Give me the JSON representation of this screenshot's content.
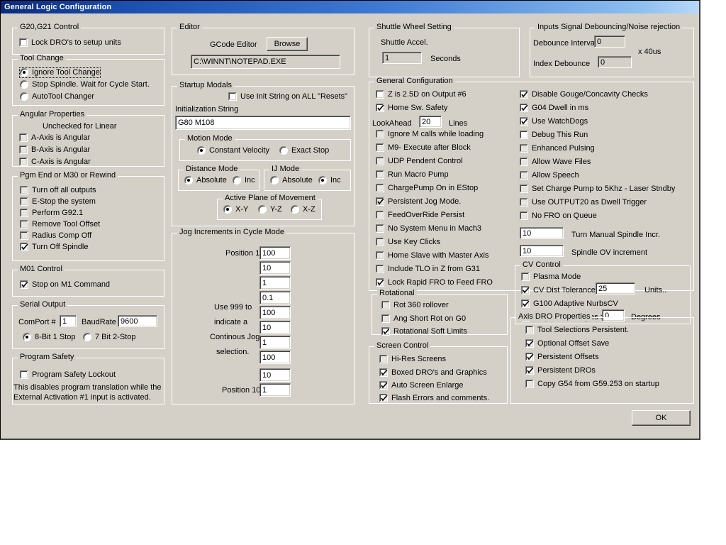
{
  "window": {
    "title": "General Logic Configuration"
  },
  "groups": {
    "g20g21": {
      "title": "G20,G21 Control",
      "lock_dro": {
        "label": "Lock DRO's to setup units",
        "checked": false
      }
    },
    "tool_change": {
      "title": "Tool Change",
      "options": [
        {
          "label": "Ignore Tool Change",
          "selected": true,
          "focused": true
        },
        {
          "label": "Stop Spindle. Wait for Cycle Start.",
          "selected": false,
          "focused": false
        },
        {
          "label": "AutoTool Changer",
          "selected": false,
          "focused": false
        }
      ]
    },
    "angular": {
      "title": "Angular Properties",
      "note": "Unchecked for Linear",
      "items": [
        {
          "label": "A-Axis is Angular",
          "checked": false
        },
        {
          "label": "B-Axis is Angular",
          "checked": false
        },
        {
          "label": "C-Axis is Angular",
          "checked": false
        }
      ]
    },
    "pgm_end": {
      "title": "Pgm End or M30 or Rewind",
      "items": [
        {
          "label": "Turn off all outputs",
          "checked": false
        },
        {
          "label": "E-Stop the system",
          "checked": false
        },
        {
          "label": "Perform G92.1",
          "checked": false
        },
        {
          "label": "Remove Tool Offset",
          "checked": false
        },
        {
          "label": "Radius Comp Off",
          "checked": false
        },
        {
          "label": "Turn Off Spindle",
          "checked": true
        }
      ]
    },
    "m01": {
      "title": "M01 Control",
      "stop_on_m1": {
        "label": "Stop on M1 Command",
        "checked": true
      }
    },
    "serial": {
      "title": "Serial Output",
      "comport_label": "ComPort #",
      "comport_value": "1",
      "baudrate_label": "BaudRate",
      "baudrate_value": "9600",
      "options": [
        {
          "label": "8-Bit 1 Stop",
          "selected": true
        },
        {
          "label": "7 Bit 2-Stop",
          "selected": false
        }
      ]
    },
    "program_safety": {
      "title": "Program Safety",
      "lockout": {
        "label": "Program Safety Lockout",
        "checked": false
      },
      "note_line1": "This disables program translation while the",
      "note_line2": "External Activation #1 input is activated."
    },
    "editor": {
      "title": "Editor",
      "gcode_editor_label": "GCode Editor",
      "browse_label": "Browse",
      "path_value": "C:\\WINNT\\NOTEPAD.EXE"
    },
    "startup_modals": {
      "title": "Startup Modals",
      "use_init_all": {
        "label": "Use Init String on ALL  \"Resets\"",
        "checked": false
      },
      "init_string_label": "Initialization String",
      "init_string_value": "G80 M108",
      "motion_mode": {
        "title": "Motion Mode",
        "options": [
          {
            "label": "Constant Velocity",
            "selected": true
          },
          {
            "label": "Exact Stop",
            "selected": false
          }
        ]
      },
      "distance_mode": {
        "title": "Distance Mode",
        "options": [
          {
            "label": "Absolute",
            "selected": true
          },
          {
            "label": "Inc",
            "selected": false
          }
        ]
      },
      "ij_mode": {
        "title": "IJ Mode",
        "options": [
          {
            "label": "Absolute",
            "selected": false
          },
          {
            "label": "Inc",
            "selected": true
          }
        ]
      },
      "active_plane": {
        "title": "Active Plane of Movement",
        "options": [
          {
            "label": "X-Y",
            "selected": true
          },
          {
            "label": "Y-Z",
            "selected": false
          },
          {
            "label": "X-Z",
            "selected": false
          }
        ]
      }
    },
    "jog": {
      "title": "Jog Increments in Cycle Mode",
      "first_label": "Position 1",
      "last_label": "Position 10",
      "note_lines": [
        "Use 999 to",
        "indicate a",
        "Continous Jog",
        "selection."
      ],
      "values": [
        "100",
        "10",
        "1",
        "0.1",
        "100",
        "10",
        "1",
        "100",
        "10",
        "1"
      ]
    },
    "shuttle": {
      "title": "Shuttle Wheel Setting",
      "accel_label": "Shuttle Accel.",
      "accel_value": "1",
      "seconds_label": "Seconds"
    },
    "debounce": {
      "title": "Inputs Signal Debouncing/Noise rejection",
      "interval_label": "Debounce Interval:",
      "interval_value": "0",
      "index_label": "Index Debounce",
      "index_value": "0",
      "units_label": "x 40us"
    },
    "general_config": {
      "title": "General Configuration",
      "left_items": [
        {
          "label": "Z is 2.5D on Output #6",
          "checked": false
        },
        {
          "label": "Home Sw. Safety",
          "checked": true
        }
      ],
      "lookahead_label": "LookAhead",
      "lookahead_value": "20",
      "lines_label": "Lines",
      "left_items2": [
        {
          "label": "Ignore M calls while loading",
          "checked": false
        },
        {
          "label": "M9- Execute after Block",
          "checked": false
        },
        {
          "label": "UDP Pendent Control",
          "checked": false
        },
        {
          "label": "Run Macro Pump",
          "checked": false
        },
        {
          "label": "ChargePump On in EStop",
          "checked": false
        },
        {
          "label": "Persistent Jog Mode.",
          "checked": true
        },
        {
          "label": "FeedOverRide Persist",
          "checked": false
        },
        {
          "label": "No System Menu in Mach3",
          "checked": false
        },
        {
          "label": "Use Key Clicks",
          "checked": false
        },
        {
          "label": "Home Slave with Master Axis",
          "checked": false
        },
        {
          "label": "Include TLO in Z from G31",
          "checked": false
        },
        {
          "label": "Lock Rapid FRO to Feed FRO",
          "checked": true
        }
      ],
      "right_items": [
        {
          "label": "Disable Gouge/Concavity Checks",
          "checked": true
        },
        {
          "label": "G04 Dwell in ms",
          "checked": true
        },
        {
          "label": "Use WatchDogs",
          "checked": true
        },
        {
          "label": "Debug This Run",
          "checked": false
        },
        {
          "label": "Enhanced Pulsing",
          "checked": false
        },
        {
          "label": "Allow Wave Files",
          "checked": false
        },
        {
          "label": "Allow Speech",
          "checked": false
        },
        {
          "label": "Set Charge Pump to 5Khz  - Laser Stndby",
          "checked": false
        },
        {
          "label": "Use OUTPUT20 as Dwell Trigger",
          "checked": false
        },
        {
          "label": "No FRO on Queue",
          "checked": false
        }
      ],
      "spindle_incr_value": "10",
      "spindle_incr_label": "Turn Manual Spindle Incr.",
      "spindle_ov_value": "10",
      "spindle_ov_label": "Spindle OV increment"
    },
    "rotational": {
      "title": "Rotational",
      "items": [
        {
          "label": "Rot 360 rollover",
          "checked": false
        },
        {
          "label": "Ang Short Rot on G0",
          "checked": false
        },
        {
          "label": "Rotational Soft Limits",
          "checked": true
        }
      ]
    },
    "screen_control": {
      "title": "Screen Control",
      "items": [
        {
          "label": "Hi-Res Screens",
          "checked": false
        },
        {
          "label": "Boxed DRO's and Graphics",
          "checked": true
        },
        {
          "label": "Auto Screen Enlarge",
          "checked": true
        },
        {
          "label": "Flash Errors and comments.",
          "checked": true
        }
      ]
    },
    "cv_control": {
      "title": "CV Control",
      "plasma": {
        "label": "Plasma Mode",
        "checked": false
      },
      "cv_dist": {
        "label": "CV Dist Tolerance",
        "checked": true
      },
      "cv_dist_value": "25",
      "units_label": "Units..",
      "nurbs": {
        "label": "G100 Adaptive NurbsCV",
        "checked": true
      },
      "stop_cv": {
        "label": "Stop CV on angles >",
        "checked": false
      },
      "stop_cv_value": "0",
      "degrees_label": "Degrees"
    },
    "axis_dro": {
      "title": "Axis DRO Properties",
      "items": [
        {
          "label": "Tool Selections Persistent.",
          "checked": false
        },
        {
          "label": "Optional Offset Save",
          "checked": true
        },
        {
          "label": "Persistent Offsets",
          "checked": true
        },
        {
          "label": "Persistent DROs",
          "checked": true
        },
        {
          "label": "Copy G54 from G59.253 on startup",
          "checked": false
        }
      ]
    }
  },
  "ok_button": {
    "label": "OK"
  }
}
